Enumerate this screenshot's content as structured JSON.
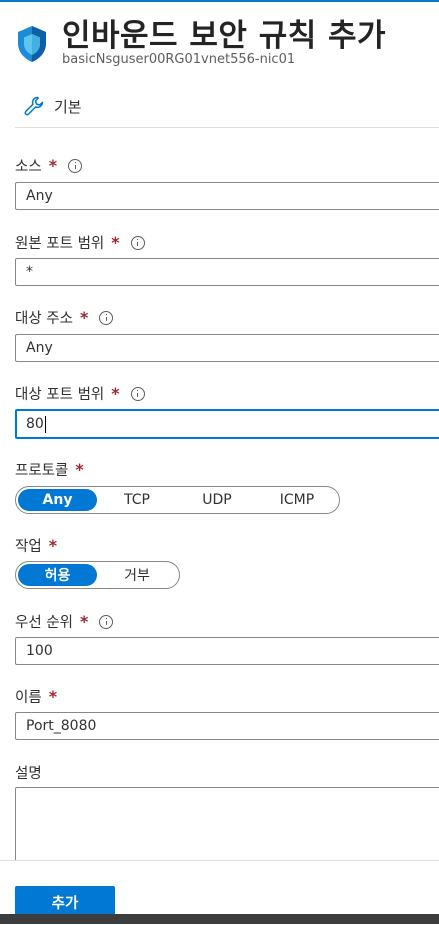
{
  "header": {
    "title": "인바운드 보안 규칙 추가",
    "subtitle": "basicNsguser00RG01vnet556-nic01",
    "icon": "shield-icon"
  },
  "tab": {
    "label": "기본",
    "icon": "wrench-icon"
  },
  "fields": {
    "source": {
      "label": "소스",
      "value": "Any"
    },
    "source_port": {
      "label": "원본 포트 범위",
      "value": "*"
    },
    "destination": {
      "label": "대상 주소",
      "value": "Any"
    },
    "dest_port": {
      "label": "대상 포트 범위",
      "value": "80"
    },
    "protocol": {
      "label": "프로토콜",
      "options": [
        "Any",
        "TCP",
        "UDP",
        "ICMP"
      ],
      "selected": "Any"
    },
    "action": {
      "label": "작업",
      "options": [
        "허용",
        "거부"
      ],
      "selected": "허용"
    },
    "priority": {
      "label": "우선 순위",
      "value": "100"
    },
    "name": {
      "label": "이름",
      "value": "Port_8080"
    },
    "description": {
      "label": "설명",
      "value": ""
    }
  },
  "required_mark": "*",
  "footer": {
    "add_label": "추가"
  },
  "colors": {
    "accent": "#0078d4",
    "required": "#a4262c",
    "border": "#8a8886"
  }
}
